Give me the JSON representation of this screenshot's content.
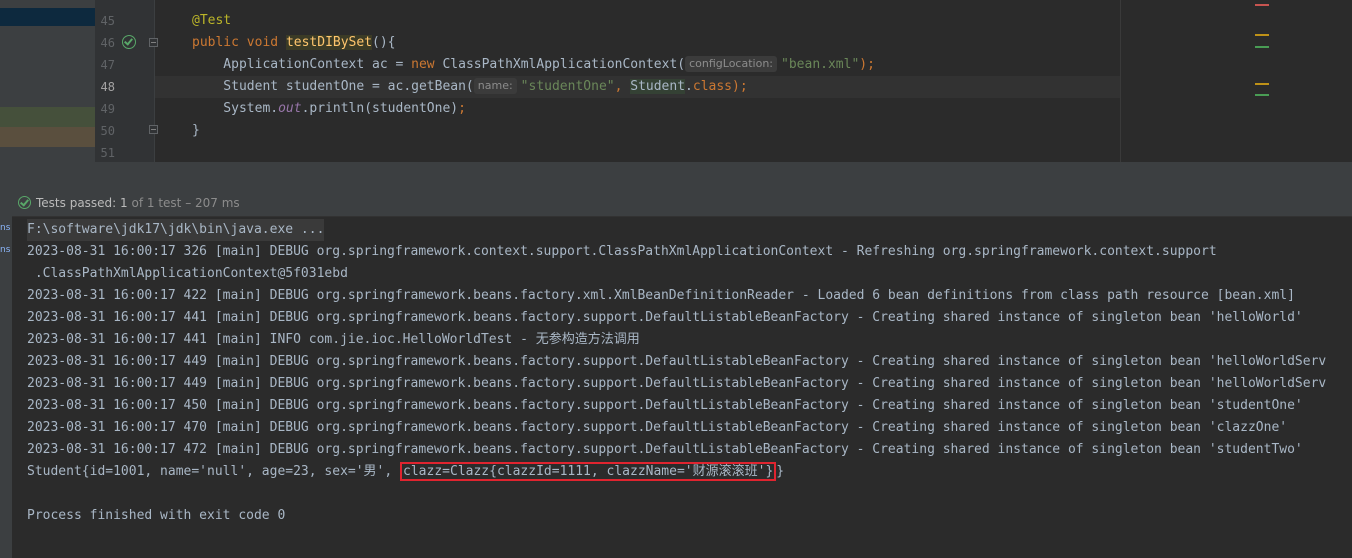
{
  "editor": {
    "lines": [
      {
        "num": "45",
        "parts": [
          {
            "t": "@Test",
            "c": "ann"
          }
        ]
      },
      {
        "num": "46",
        "parts": [
          {
            "t": "public ",
            "c": "kw"
          },
          {
            "t": "void ",
            "c": "kw"
          },
          {
            "t": "testDIBySet",
            "c": "fn-hl"
          },
          {
            "t": "(){",
            "c": ""
          }
        ]
      },
      {
        "num": "47",
        "parts": [
          {
            "t": "    ApplicationContext ac = ",
            "c": ""
          },
          {
            "t": "new ",
            "c": "kw"
          },
          {
            "t": "ClassPathXmlApplicationContext(",
            "c": ""
          },
          {
            "t": "configLocation:",
            "c": "hint"
          },
          {
            "t": "\"bean.xml\"",
            "c": "str"
          },
          {
            "t": ");",
            "c": "kw"
          }
        ]
      },
      {
        "num": "48",
        "parts": [
          {
            "t": "    Student studentOne = ac.getBean(",
            "c": ""
          },
          {
            "t": "name:",
            "c": "hint"
          },
          {
            "t": "\"studentOne\"",
            "c": "str"
          },
          {
            "t": ", ",
            "c": "kw"
          },
          {
            "t": "Student",
            "c": "cls-hl"
          },
          {
            "t": ".",
            "c": ""
          },
          {
            "t": "class",
            "c": "kw"
          },
          {
            "t": ");",
            "c": "kw"
          }
        ]
      },
      {
        "num": "49",
        "parts": [
          {
            "t": "    System.",
            "c": ""
          },
          {
            "t": "out",
            "c": "fld"
          },
          {
            "t": ".println(studentOne)",
            "c": ""
          },
          {
            "t": ";",
            "c": "kw"
          }
        ]
      },
      {
        "num": "50",
        "parts": [
          {
            "t": "}",
            "c": ""
          }
        ]
      },
      {
        "num": "51",
        "parts": []
      }
    ]
  },
  "test_bar": {
    "status": "Tests passed:",
    "count": "1",
    "detail": "of 1 test – 207 ms"
  },
  "side": {
    "a": "ns",
    "b": "ns"
  },
  "console": {
    "command": "F:\\software\\jdk17\\jdk\\bin\\java.exe ...",
    "lines": [
      "2023-08-31 16:00:17 326 [main] DEBUG org.springframework.context.support.ClassPathXmlApplicationContext - Refreshing org.springframework.context.support",
      " .ClassPathXmlApplicationContext@5f031ebd",
      "2023-08-31 16:00:17 422 [main] DEBUG org.springframework.beans.factory.xml.XmlBeanDefinitionReader - Loaded 6 bean definitions from class path resource [bean.xml]",
      "2023-08-31 16:00:17 441 [main] DEBUG org.springframework.beans.factory.support.DefaultListableBeanFactory - Creating shared instance of singleton bean 'helloWorld'",
      "2023-08-31 16:00:17 441 [main] INFO com.jie.ioc.HelloWorldTest - 无参构造方法调用",
      "2023-08-31 16:00:17 449 [main] DEBUG org.springframework.beans.factory.support.DefaultListableBeanFactory - Creating shared instance of singleton bean 'helloWorldServ",
      "2023-08-31 16:00:17 449 [main] DEBUG org.springframework.beans.factory.support.DefaultListableBeanFactory - Creating shared instance of singleton bean 'helloWorldServ",
      "2023-08-31 16:00:17 450 [main] DEBUG org.springframework.beans.factory.support.DefaultListableBeanFactory - Creating shared instance of singleton bean 'studentOne'",
      "2023-08-31 16:00:17 470 [main] DEBUG org.springframework.beans.factory.support.DefaultListableBeanFactory - Creating shared instance of singleton bean 'clazzOne'",
      "2023-08-31 16:00:17 472 [main] DEBUG org.springframework.beans.factory.support.DefaultListableBeanFactory - Creating shared instance of singleton bean 'studentTwo'"
    ],
    "result_prefix": "Student{id=1001, name='null', age=23, sex='男', ",
    "result_highlight": "clazz=Clazz{clazzId=1111, clazzName='财源滚滚班'}",
    "result_suffix": "}",
    "exit": "Process finished with exit code 0"
  }
}
